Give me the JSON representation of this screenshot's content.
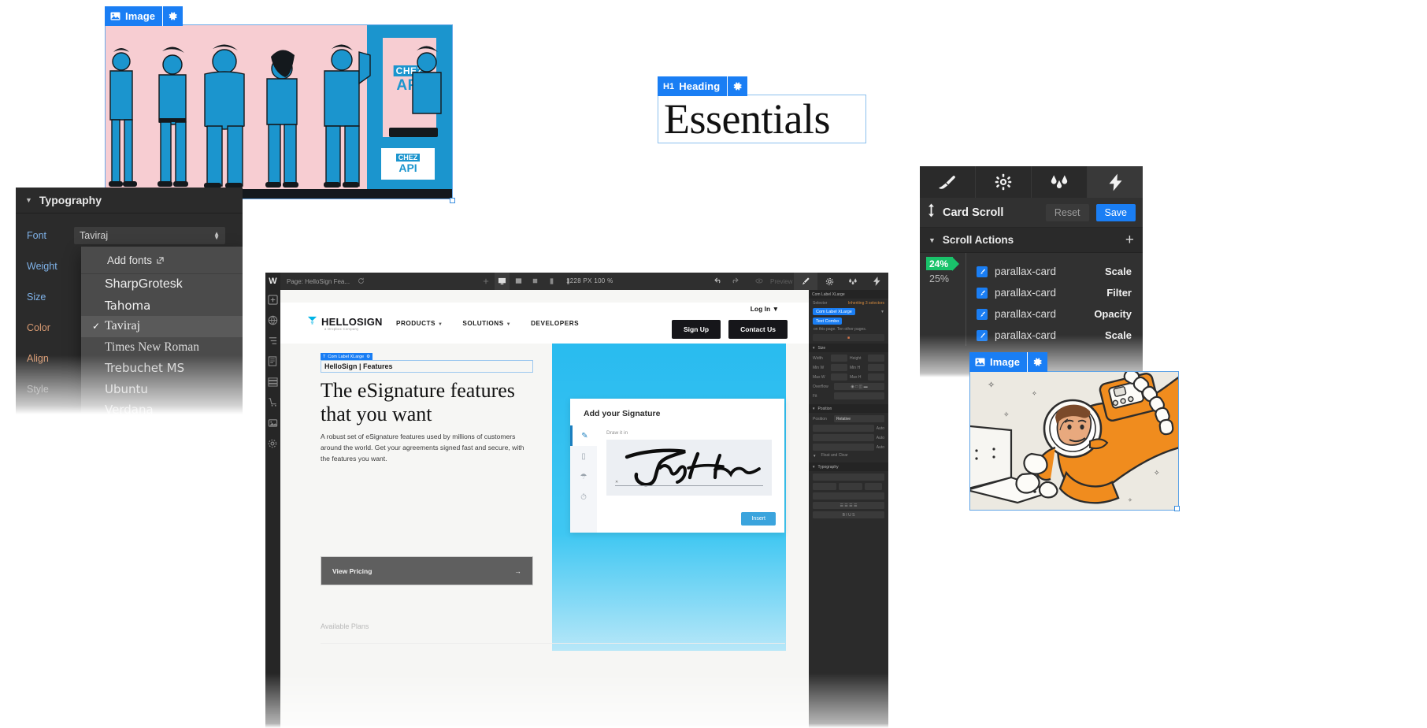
{
  "canvas": {
    "image_badge_top": {
      "label": "Image",
      "icon": "image-icon",
      "gear": "gear-icon"
    },
    "heading_badge": {
      "tag": "H1",
      "label": "Heading",
      "gear": "gear-icon"
    },
    "heading_text": "Essentials",
    "illustration_people": {
      "sign_line1": "CHEZ",
      "sign_line2": "API",
      "desk_sign_line1": "CHEZ",
      "desk_sign_line2": "API",
      "background_color": "#f7cdd2",
      "figure_color": "#1b95ce"
    },
    "image_badge_astronaut": {
      "label": "Image",
      "icon": "image-icon",
      "gear": "gear-icon"
    }
  },
  "typography_panel": {
    "title": "Typography",
    "caret": "caret-down-icon",
    "rows": [
      {
        "key": "Font"
      },
      {
        "key": "Weight"
      },
      {
        "key": "Size"
      },
      {
        "key": "Color"
      },
      {
        "key": "Align"
      },
      {
        "key": "Style"
      }
    ],
    "font_field_value": "Taviraj",
    "dropdown": {
      "add_fonts_label": "Add fonts",
      "add_fonts_icon": "external-link-icon",
      "options": [
        {
          "name": "SharpGrotesk",
          "selected": false
        },
        {
          "name": "Tahoma",
          "selected": false
        },
        {
          "name": "Taviraj",
          "selected": true
        },
        {
          "name": "Times New Roman",
          "selected": false
        },
        {
          "name": "Trebuchet MS",
          "selected": false
        },
        {
          "name": "Ubuntu",
          "selected": false
        },
        {
          "name": "Verdana",
          "selected": false
        }
      ]
    }
  },
  "designer_window": {
    "topbar": {
      "logo": "W",
      "page_label": "Page: HelloSign Fea...",
      "refresh_icon": "refresh-icon",
      "zoom_label": "1228 PX  100 %",
      "breakpoints": [
        "desktop",
        "tablet",
        "mobile-landscape",
        "mobile-portrait"
      ],
      "preview_label": "Preview"
    },
    "site": {
      "logo_text": "HELLOSIGN",
      "logo_sub": "a Dropbox Company",
      "nav_links": [
        "PRODUCTS",
        "SOLUTIONS",
        "DEVELOPERS"
      ],
      "login": "Log In",
      "buttons": [
        "Sign Up",
        "Contact Us"
      ],
      "breadcrumb_badge": "Com Label XLarge",
      "breadcrumb_text": "HelloSign | Features",
      "headline": "The eSignature features that you want",
      "paragraph": "A robust set of eSignature features used by millions of customers around the world. Get your agreements signed fast and secure, with the features you want.",
      "cta_label": "View Pricing",
      "cta_icon": "arrow-right-icon",
      "section_label": "Available Plans"
    },
    "signature_widget": {
      "title": "Add your Signature",
      "hint": "Draw it in",
      "signature_text": "Jmmy Herrn",
      "insert_label": "Insert",
      "rail_icons": [
        "pen-icon",
        "type-icon",
        "camera-icon",
        "clock-icon"
      ]
    },
    "right_panel": {
      "selector_label": "Com Label XLarge",
      "chip": "Com Label XLarge",
      "chip2": "Text Combo",
      "inheriting_note": "Inheriting 3 selectors",
      "hint": "on this page. Ten other pages.",
      "sections": [
        "Size",
        "Position",
        "Typography"
      ],
      "size_fields": [
        "Width",
        "Height",
        "Min W",
        "Min H",
        "Max W",
        "Max H",
        "Overflow",
        "Fit"
      ],
      "value_auto": "Auto",
      "position_label": "Position",
      "position_value": "Relative",
      "float_label": "Float and Clear"
    }
  },
  "card_scroll_panel": {
    "tabs": [
      {
        "name": "style-tab",
        "icon": "brush-icon",
        "active": false
      },
      {
        "name": "settings-tab",
        "icon": "gear-icon",
        "active": false
      },
      {
        "name": "effects-tab",
        "icon": "drops-icon",
        "active": false
      },
      {
        "name": "interactions-tab",
        "icon": "lightning-icon",
        "active": true
      }
    ],
    "title": "Card Scroll",
    "title_icon": "vertical-arrows-icon",
    "reset_label": "Reset",
    "save_label": "Save",
    "section_label": "Scroll Actions",
    "section_caret": "caret-down-icon",
    "add_icon": "plus-icon",
    "progress_tag": "24%",
    "progress_secondary": "25%",
    "actions": [
      {
        "checked": true,
        "target": "parallax-card",
        "action": "Scale"
      },
      {
        "checked": true,
        "target": "parallax-card",
        "action": "Filter"
      },
      {
        "checked": true,
        "target": "parallax-card",
        "action": "Opacity"
      },
      {
        "checked": true,
        "target": "parallax-card",
        "action": "Scale"
      }
    ]
  },
  "colors": {
    "accent_blue": "#1a7ef4",
    "selection_outline": "#58a6f0",
    "green_tag": "#19c26a",
    "panel_dark": "#2b2b2b",
    "panel_dark_alt": "#313131",
    "illustration_blue": "#1b95ce",
    "illustration_pink": "#f7cdd2",
    "astronaut_orange": "#f08c1e",
    "hero_cyan": "#29bbef"
  }
}
